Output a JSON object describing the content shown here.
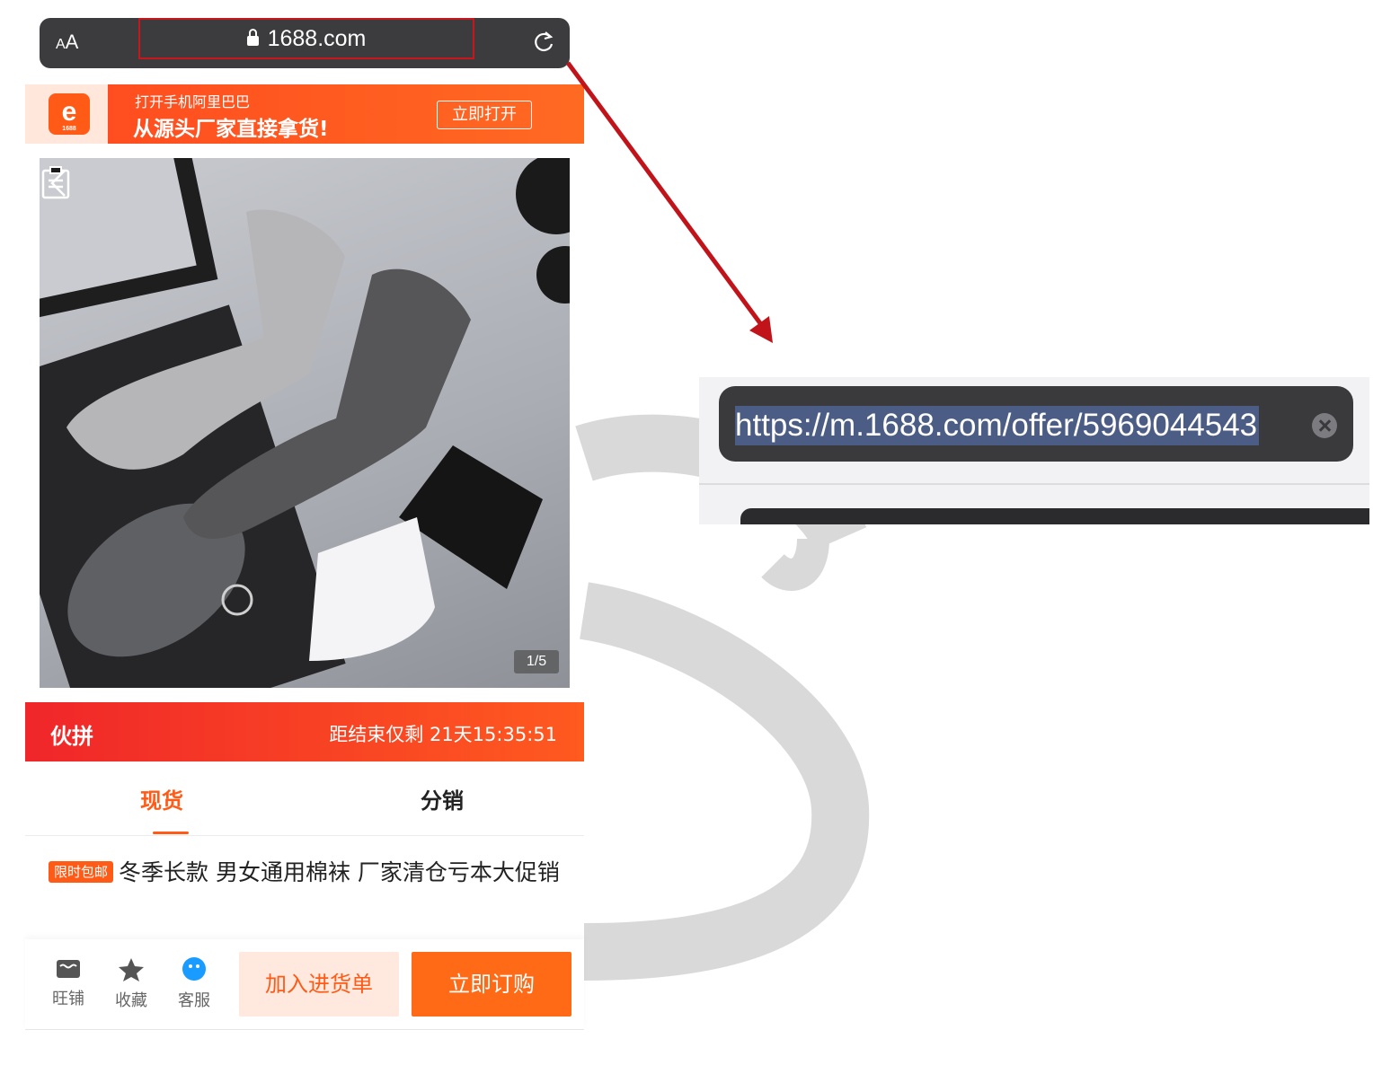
{
  "browser": {
    "text_size_label": "AA",
    "domain": "1688.com"
  },
  "app_banner": {
    "logo_text": "1688",
    "line1": "打开手机阿里巴巴",
    "line2": "从源头厂家直接拿货!",
    "open_button": "立即打开"
  },
  "gallery": {
    "counter": "1/5"
  },
  "group_buy": {
    "label": "伙拼",
    "countdown": "距结束仅剩 21天15:35:51"
  },
  "tabs": [
    "现货",
    "分销"
  ],
  "product": {
    "badge": "限时包邮",
    "title": "冬季长款 男女通用棉袜 厂家清仓亏本大促销"
  },
  "bottom_bar": {
    "icons": [
      {
        "label": "旺铺",
        "icon": "shop-icon"
      },
      {
        "label": "收藏",
        "icon": "star-icon"
      },
      {
        "label": "客服",
        "icon": "chat-icon"
      }
    ],
    "add_button": "加入进货单",
    "buy_button": "立即订购"
  },
  "zoomed_address": {
    "url": "https://m.1688.com/offer/5969044543"
  },
  "colors": {
    "accent": "#ff5a16",
    "highlight_border": "#c8161d",
    "arrow": "#c0141a"
  }
}
